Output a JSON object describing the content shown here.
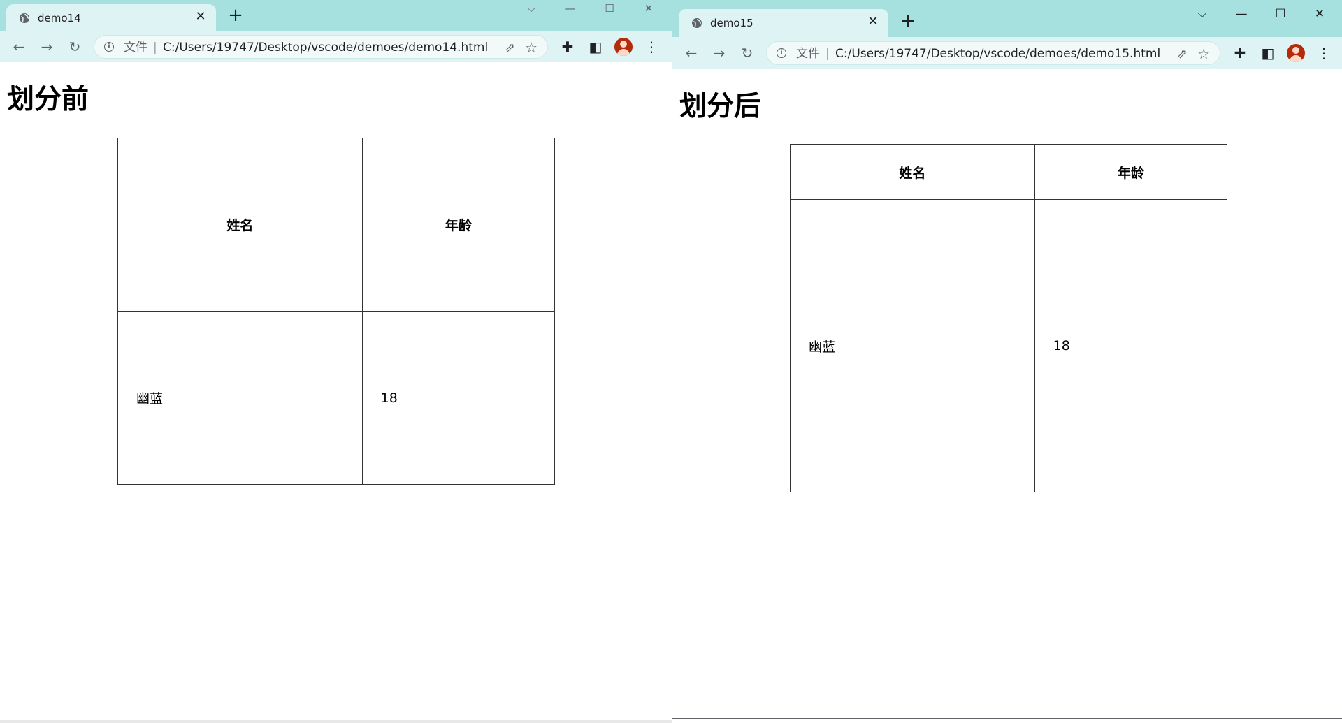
{
  "windows": [
    {
      "tab_title": "demo14",
      "file_label": "文件",
      "url": "C:/Users/19747/Desktop/vscode/demoes/demo14.html",
      "heading": "划分前",
      "table": {
        "headers": [
          "姓名",
          "年龄"
        ],
        "rows": [
          [
            "幽蓝",
            "18"
          ]
        ]
      }
    },
    {
      "tab_title": "demo15",
      "file_label": "文件",
      "url": "C:/Users/19747/Desktop/vscode/demoes/demo15.html",
      "heading": "划分后",
      "table": {
        "headers": [
          "姓名",
          "年龄"
        ],
        "rows": [
          [
            "幽蓝",
            "18"
          ]
        ]
      }
    }
  ],
  "icons": {
    "tab": "globe-icon",
    "close": "close-icon",
    "new_tab": "plus-icon",
    "back": "back-arrow-icon",
    "forward": "forward-arrow-icon",
    "reload": "reload-icon",
    "info": "info-icon",
    "share": "share-icon",
    "bookmark": "star-icon",
    "extensions": "puzzle-icon",
    "side_panel": "side-panel-icon",
    "profile": "avatar-icon",
    "menu": "kebab-menu-icon"
  },
  "colors": {
    "tabstrip": "#a6e1df",
    "toolbar": "#def3f3",
    "avatar": "#b52a0a"
  }
}
